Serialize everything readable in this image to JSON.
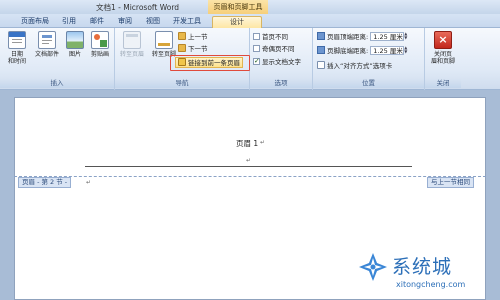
{
  "window": {
    "title": "文档1 - Microsoft Word",
    "context_tab_title": "页眉和页脚工具"
  },
  "tabs": [
    {
      "label": "页面布局"
    },
    {
      "label": "引用"
    },
    {
      "label": "邮件"
    },
    {
      "label": "审阅"
    },
    {
      "label": "视图"
    },
    {
      "label": "开发工具"
    },
    {
      "label": "设计",
      "active": true
    }
  ],
  "ribbon": {
    "insert": {
      "label": "插入",
      "buttons": [
        {
          "label1": "日期",
          "label2": "和时间",
          "icon": "calendar-icon"
        },
        {
          "label1": "文档部件",
          "label2": "",
          "icon": "document-parts-icon"
        },
        {
          "label1": "图片",
          "label2": "",
          "icon": "picture-icon"
        },
        {
          "label1": "剪贴画",
          "label2": "",
          "icon": "clipart-icon"
        }
      ]
    },
    "nav": {
      "label": "导航",
      "goto_header": "转至页眉",
      "goto_footer": "转至页脚",
      "prev_section": "上一节",
      "next_section": "下一节",
      "link_previous": "链接到前一条页眉"
    },
    "options": {
      "label": "选项",
      "items": [
        {
          "label": "首页不同",
          "checked": false
        },
        {
          "label": "奇偶页不同",
          "checked": false
        },
        {
          "label": "显示文档文字",
          "checked": true
        }
      ]
    },
    "position": {
      "label": "位置",
      "header_top_label": "页眉顶端距离:",
      "header_top_value": "1.25 厘米",
      "footer_bottom_label": "页脚底端距离:",
      "footer_bottom_value": "1.25 厘米",
      "insert_align_tab": "插入“对齐方式”选项卡"
    },
    "close": {
      "label": "关闭",
      "button_line1": "关闭页",
      "button_line2": "眉和页脚"
    }
  },
  "document": {
    "header_text": "页眉 1",
    "paragraph_mark": "↵",
    "section_label": "页眉 - 第 2 节 -",
    "same_as_previous": "与上一节相同"
  },
  "watermark": {
    "text": "系统城",
    "url": "xitongcheng.com"
  }
}
